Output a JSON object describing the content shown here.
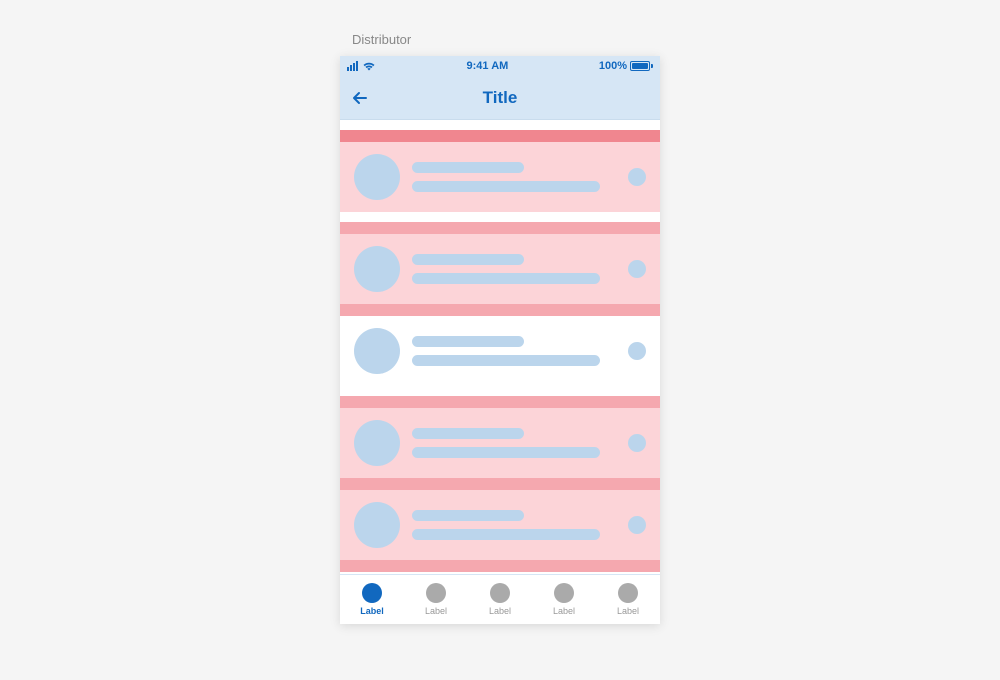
{
  "outer_label": "Distributor",
  "status": {
    "time": "9:41 AM",
    "battery_pct": "100%"
  },
  "nav": {
    "title": "Title"
  },
  "tabs": [
    {
      "label": "Label",
      "active": true
    },
    {
      "label": "Label",
      "active": false
    },
    {
      "label": "Label",
      "active": false
    },
    {
      "label": "Label",
      "active": false
    },
    {
      "label": "Label",
      "active": false
    }
  ],
  "colors": {
    "accent": "#1168bf",
    "status_bg": "#d6e6f5",
    "placeholder": "#bbd5ec",
    "row_highlight": "#fcd4d8",
    "row_header": "#f5a8af"
  }
}
